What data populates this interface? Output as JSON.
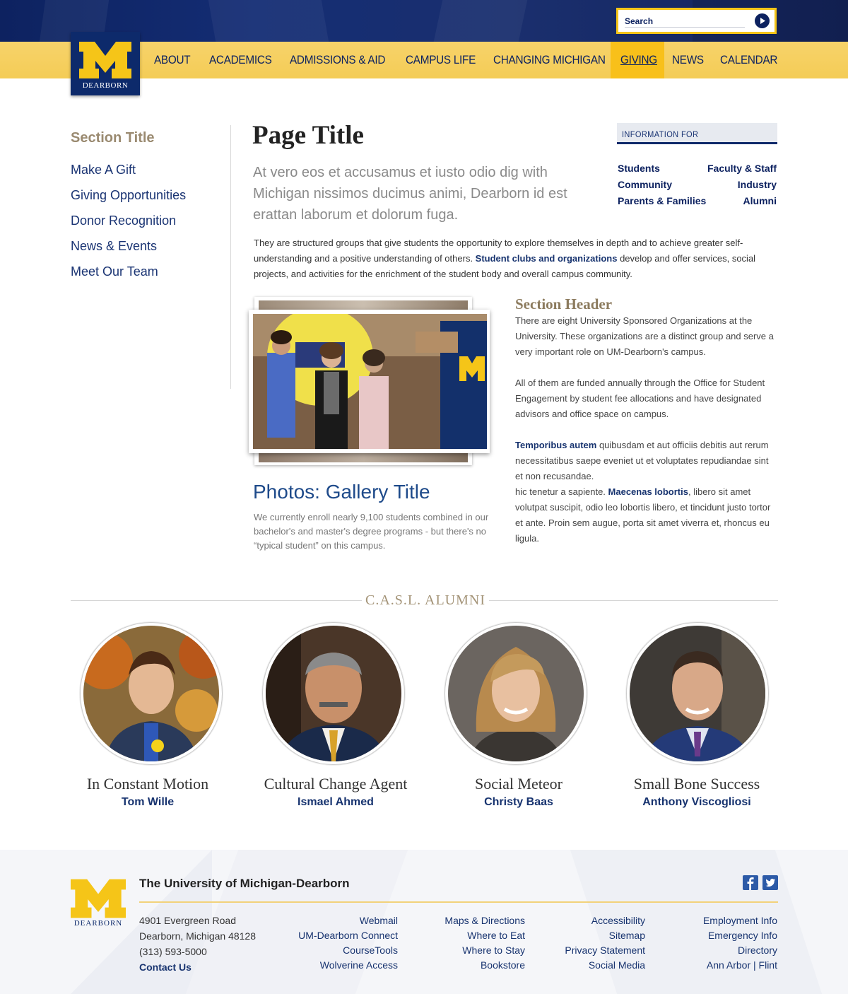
{
  "colors": {
    "navy": "#0d2260",
    "maize": "#f4cc56",
    "maize_active": "#f8c01a",
    "tan": "#9a8a70"
  },
  "header": {
    "search": {
      "placeholder": "Search",
      "icon": "arrow-right-circle-icon"
    },
    "logo": {
      "mark": "M",
      "text": "DEARBORN"
    },
    "nav": [
      {
        "label": "ABOUT",
        "active": false
      },
      {
        "label": "ACADEMICS",
        "active": false
      },
      {
        "label": "ADMISSIONS & AID",
        "active": false
      },
      {
        "label": "CAMPUS LIFE",
        "active": false
      },
      {
        "label": "CHANGING MICHIGAN",
        "active": false
      },
      {
        "label": "GIVING",
        "active": true
      },
      {
        "label": "NEWS",
        "active": false
      },
      {
        "label": "CALENDAR",
        "active": false
      }
    ]
  },
  "sidebar": {
    "section_title": "Section Title",
    "items": [
      {
        "label": "Make A Gift"
      },
      {
        "label": "Giving Opportunities"
      },
      {
        "label": "Donor Recognition"
      },
      {
        "label": "News & Events"
      },
      {
        "label": "Meet Our Team"
      }
    ]
  },
  "main": {
    "title": "Page Title",
    "lead": "At vero eos et accusamus et iusto odio dig with Michigan nissimos ducimus animi, Dearborn id est erattan laborum et dolorum fuga.",
    "body": {
      "part1": "They are structured groups that give students the opportunity to explore themselves in depth and to achieve greater self-understanding and a positive understanding of others. ",
      "link": "Student clubs and organizations",
      "part2": " develop and offer services, social projects, and activities for the enrichment of the student body and overall campus community."
    },
    "gallery": {
      "title": "Photos: Gallery Title",
      "caption": "We currently enroll nearly 9,100 students combined in our bachelor's and master's degree programs - but there's no “typical student” on this campus."
    },
    "section": {
      "header": "Section Header",
      "p1": "There are eight University Sponsored Organizations at the University. These organizations are a distinct group and serve a very important role on UM-Dearborn's campus.",
      "p2": "All of them are funded annually through the Office for Student Engagement by student fee allocations and have designated advisors and office space on campus.",
      "p3_bold": "Temporibus autem",
      "p3_rest": " quibusdam et aut officiis debitis aut rerum necessitatibus saepe eveniet ut et voluptates repudiandae sint et non recusandae.",
      "p4_start": "hic tenetur a sapiente. ",
      "p4_bold": "Maecenas lobortis",
      "p4_rest": ", libero sit amet volutpat suscipit, odio leo lobortis libero, et tincidunt justo tortor et ante. Proin sem augue, porta sit amet viverra et, rhoncus eu ligula."
    }
  },
  "info_for": {
    "heading": "INFORMATION FOR",
    "links": [
      "Students",
      "Faculty & Staff",
      "Community",
      "Industry",
      "Parents & Families",
      "Alumni"
    ]
  },
  "alumni": {
    "title": "C.A.S.L. ALUMNI",
    "people": [
      {
        "caption": "In Constant Motion",
        "name": "Tom Wille"
      },
      {
        "caption": "Cultural Change Agent",
        "name": "Ismael Ahmed"
      },
      {
        "caption": "Social Meteor",
        "name": "Christy Baas"
      },
      {
        "caption": "Small Bone Success",
        "name": "Anthony Viscogliosi"
      }
    ]
  },
  "footer": {
    "title": "The University of Michigan-Dearborn",
    "logo_text": "DEARBORN",
    "social": [
      "facebook-icon",
      "twitter-icon"
    ],
    "address": [
      "4901 Evergreen Road",
      "Dearborn, Michigan 48128",
      "(313) 593-5000"
    ],
    "contact": "Contact Us",
    "columns": [
      [
        "Webmail",
        "UM-Dearborn Connect",
        "CourseTools",
        "Wolverine Access"
      ],
      [
        "Maps & Directions",
        "Where to Eat",
        "Where to Stay",
        "Bookstore"
      ],
      [
        "Accessibility",
        "Sitemap",
        "Privacy Statement",
        "Social Media"
      ],
      [
        "Employment Info",
        "Emergency Info",
        "Directory",
        "Ann Arbor | Flint"
      ]
    ]
  }
}
